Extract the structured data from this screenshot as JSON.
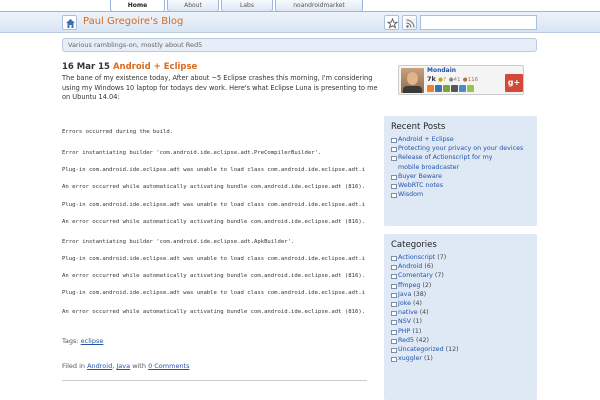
{
  "tabs": [
    {
      "label": "Home",
      "active": true
    },
    {
      "label": "About",
      "active": false
    },
    {
      "label": "Labs",
      "active": false
    },
    {
      "label": "noandroidmarket",
      "active": false
    }
  ],
  "header": {
    "title": "Paul Gregoire's Blog",
    "search_value": ""
  },
  "description": "Various ramblings-on, mostly about Red5",
  "post": {
    "date": "16 Mar 15",
    "title": "Android + Eclipse",
    "intro": "The bane of my existence today, After about ~5 Eclipse crashes this morning, I'm considering using my Windows 10 laptop for todays dev work. Here's what Eclipse Luna is presenting to me on Ubuntu 14.04:",
    "code_lines": [
      "Errors occurred during the build.",
      "Error instantiating builder 'com.android.ide.eclipse.adt.PreCompilerBuilder'.",
      "Plug-in com.android.ide.eclipse.adt was unable to load class com.android.ide.eclipse.adt.i",
      "An error occurred while automatically activating bundle com.android.ide.eclipse.adt (816).",
      "Plug-in com.android.ide.eclipse.adt was unable to load class com.android.ide.eclipse.adt.i",
      "An error occurred while automatically activating bundle com.android.ide.eclipse.adt (816).",
      "Error instantiating builder 'com.android.ide.eclipse.adt.ApkBuilder'.",
      "Plug-in com.android.ide.eclipse.adt was unable to load class com.android.ide.eclipse.adt.i",
      "An error occurred while automatically activating bundle com.android.ide.eclipse.adt (816).",
      "Plug-in com.android.ide.eclipse.adt was unable to load class com.android.ide.eclipse.adt.i",
      "An error occurred while automatically activating bundle com.android.ide.eclipse.adt (816)."
    ],
    "tags_label": "Tags:",
    "tag": "eclipse",
    "filed_prefix": "Filed in",
    "filed_cat1": "Android",
    "filed_comma": ",",
    "filed_cat2": "Java",
    "filed_with": "with",
    "comments": "0 Comments"
  },
  "profile": {
    "name": "Mondain",
    "rep": "7k",
    "gold": "●7",
    "silver": "●41",
    "bronze": "●116",
    "gplus": "g+"
  },
  "recent_posts": {
    "title": "Recent Posts",
    "items": [
      "Android + Eclipse",
      "Protecting your privacy on your devices",
      "Release of Actionscript for my mobile broadcaster",
      "Buyer Beware",
      "WebRTC notes",
      "Wisdom"
    ]
  },
  "categories": {
    "title": "Categories",
    "items": [
      {
        "name": "Actionscript",
        "count": "(7)"
      },
      {
        "name": "Android",
        "count": "(6)"
      },
      {
        "name": "Comentary",
        "count": "(7)"
      },
      {
        "name": "ffmpeg",
        "count": "(2)"
      },
      {
        "name": "Java",
        "count": "(38)"
      },
      {
        "name": "Joke",
        "count": "(4)"
      },
      {
        "name": "native",
        "count": "(4)"
      },
      {
        "name": "NSV",
        "count": "(1)"
      },
      {
        "name": "PHP",
        "count": "(1)"
      },
      {
        "name": "Red5",
        "count": "(42)"
      },
      {
        "name": "Uncategorized",
        "count": "(12)"
      },
      {
        "name": "xuggler",
        "count": "(1)"
      }
    ]
  },
  "colors": {
    "accent": "#d96a1a",
    "link": "#2255aa",
    "panel": "#dfe9f6"
  }
}
